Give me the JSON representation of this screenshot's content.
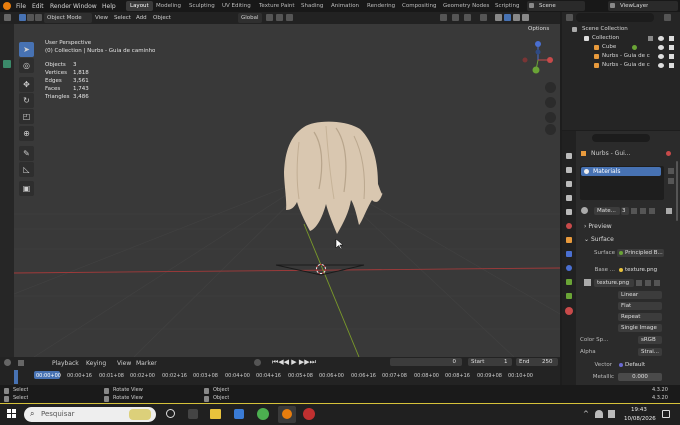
{
  "menu": [
    "File",
    "Edit",
    "Render",
    "Window",
    "Help"
  ],
  "workspaces": [
    "Layout",
    "Modeling",
    "Sculpting",
    "UV Editing",
    "Texture Paint",
    "Shading",
    "Animation",
    "Rendering",
    "Compositing",
    "Geometry Nodes",
    "Scripting"
  ],
  "scene": {
    "label": "Scene",
    "viewlayer": "ViewLayer"
  },
  "viewport_header": {
    "mode": "Object Mode",
    "view": "View",
    "select": "Select",
    "add": "Add",
    "object": "Object",
    "transform": "Global",
    "options": "Options"
  },
  "overlay": {
    "perspective": "User Perspective",
    "collection_path": "(0) Collection | Nurbs - Guia de caminho",
    "stats": [
      {
        "label": "Objects",
        "value": "3"
      },
      {
        "label": "Vertices",
        "value": "1,818"
      },
      {
        "label": "Edges",
        "value": "3,561"
      },
      {
        "label": "Faces",
        "value": "1,743"
      },
      {
        "label": "Triangles",
        "value": "3,486"
      }
    ]
  },
  "outliner": {
    "search": "",
    "items": [
      {
        "label": "Scene Collection"
      },
      {
        "label": "Collection"
      },
      {
        "label": "Cube"
      },
      {
        "label": "Nurbs - Guia de c"
      },
      {
        "label": "Nurbs - Guia de c"
      }
    ]
  },
  "properties": {
    "object_name": "Nurbs - Gui...",
    "material_slot": "Materials",
    "material_name": "Mate...",
    "user_count": "3",
    "sections": {
      "preview": "Preview",
      "surface": "Surface"
    },
    "surface_label": "Surface",
    "surface_value": "Principled B...",
    "base_color_label": "Base ...",
    "base_color_value": "texture.png",
    "image_name": "texture.png",
    "interp": "Linear",
    "projection": "Flat",
    "extension": "Repeat",
    "source": "Single Image",
    "colorspace_label": "Color Sp...",
    "colorspace_value": "sRGB",
    "alpha_label": "Alpha",
    "alpha_value": "Strai...",
    "vector_label": "Vector",
    "vector_value": "Default",
    "metallic_label": "Metallic",
    "metallic_value": "0.000"
  },
  "timeline": {
    "playback": "Playback",
    "keying": "Keying",
    "view": "View",
    "marker": "Marker",
    "current_frame": "0",
    "start_label": "Start",
    "start": "1",
    "end_label": "End",
    "end": "250",
    "frames": [
      "00:00+00",
      "00:00+16",
      "00:01+08",
      "00:02+00",
      "00:02+16",
      "00:03+08",
      "00:04+00",
      "00:04+16",
      "00:05+08",
      "00:06+00",
      "00:06+16",
      "00:07+08",
      "00:08+00",
      "00:08+16",
      "00:09+08",
      "00:10+00"
    ]
  },
  "statusbar": {
    "row1": [
      "Select",
      "Rotate View",
      "Object"
    ],
    "row2": [
      "Select",
      "Rotate View",
      "Object"
    ],
    "version1": "4.3.20",
    "version2": "4.3.20"
  },
  "taskbar": {
    "search_placeholder": "Pesquisar",
    "time": "19:43",
    "date": "10/08/2026"
  },
  "colors": {
    "accent": "#4772b3",
    "axis_x": "#a33a3a",
    "axis_y": "#7a9a2a",
    "hair": "#d9c7b0"
  }
}
